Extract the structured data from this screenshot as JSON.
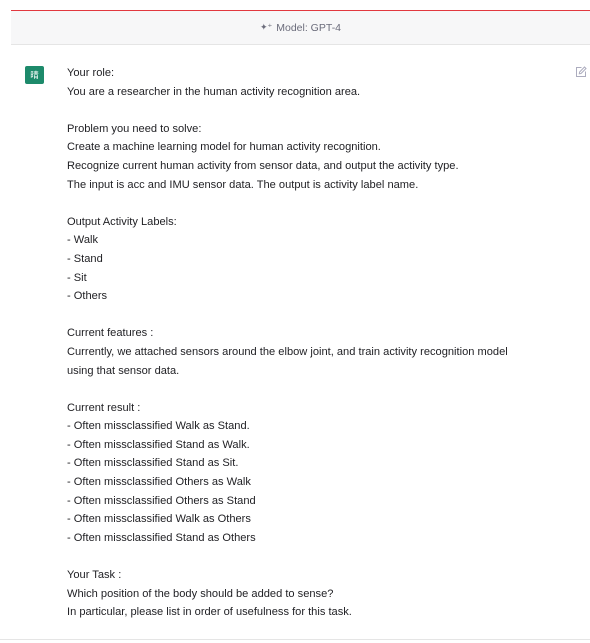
{
  "header": {
    "model_label": "Model: GPT-4",
    "model_icon": "sparkle-icon"
  },
  "message": {
    "avatar_text": "晴",
    "avatar_color": "#1d8a6b",
    "edit_icon": "edit-icon",
    "blocks": [
      {
        "lines": [
          "Your role:",
          "You are a researcher in the human activity recognition area."
        ]
      },
      {
        "lines": [
          "Problem you need to solve:",
          "Create a machine learning model for human activity recognition.",
          "Recognize current human activity from sensor data, and output the activity type.",
          "The input is acc and IMU sensor data. The output is activity label name."
        ]
      },
      {
        "lines": [
          "Output Activity Labels:",
          "- Walk",
          "- Stand",
          "- Sit",
          "- Others"
        ]
      },
      {
        "lines": [
          "Current features :",
          "Currently, we attached sensors around the elbow joint, and train activity recognition model",
          "using that sensor data."
        ]
      },
      {
        "lines": [
          "Current result :",
          "- Often missclassified Walk as Stand.",
          "- Often missclassified Stand as Walk.",
          "- Often missclassified Stand as Sit.",
          "- Often missclassified Others as Walk",
          "- Often missclassified Others as Stand",
          "- Often missclassified Walk as Others",
          "- Often missclassified Stand as Others"
        ]
      },
      {
        "lines": [
          "Your Task :",
          "Which position of the body should be added to sense?",
          "In particular, please list in order of usefulness for this task."
        ]
      }
    ]
  }
}
